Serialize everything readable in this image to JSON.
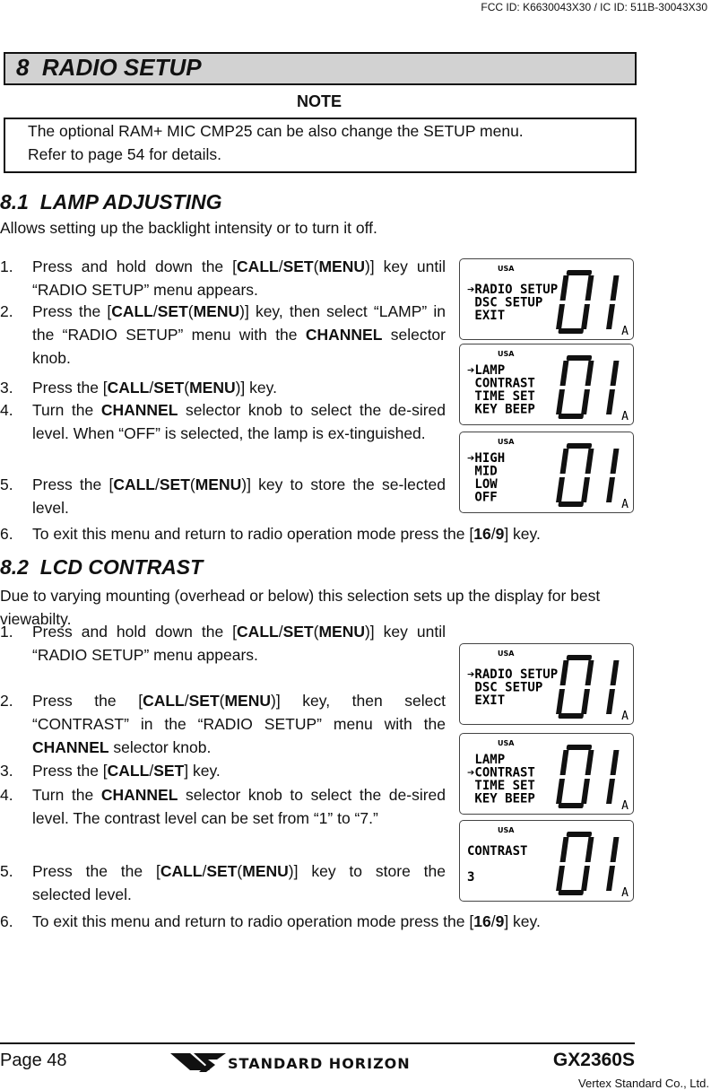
{
  "header": {
    "fcc_id": "FCC ID: K6630043X30 / IC ID: 511B-30043X30",
    "section_title": "8  RADIO SETUP"
  },
  "note": {
    "label": "NOTE",
    "lines": [
      "The optional RAM+ MIC CMP25 can be also change the SETUP menu.",
      "Refer to page 54 for details."
    ]
  },
  "lamp": {
    "heading": "8.1  LAMP ADJUSTING",
    "intro": "Allows setting up the backlight intensity or to turn it off.",
    "steps": [
      {
        "num": "1.",
        "segs": [
          [
            "Press and hold down the ",
            0
          ],
          [
            "[",
            0
          ],
          [
            "CALL",
            1
          ],
          [
            "/",
            0
          ],
          [
            "SET",
            1
          ],
          [
            "(",
            0
          ],
          [
            "MENU",
            1
          ],
          [
            ")] key until “RADIO SETUP” menu appears.",
            0
          ]
        ]
      },
      {
        "num": "2.",
        "segs": [
          [
            "Press the [",
            0
          ],
          [
            "CALL",
            1
          ],
          [
            "/",
            0
          ],
          [
            "SET",
            1
          ],
          [
            "(",
            0
          ],
          [
            "MENU",
            1
          ],
          [
            ")] key, then select “LAMP” in the “RADIO SETUP” menu with the ",
            0
          ],
          [
            "CHANNEL",
            1
          ],
          [
            " selector knob.",
            0
          ]
        ]
      },
      {
        "num": "3.",
        "segs": [
          [
            "Press the [",
            0
          ],
          [
            "CALL",
            1
          ],
          [
            "/",
            0
          ],
          [
            "SET",
            1
          ],
          [
            "(",
            0
          ],
          [
            "MENU",
            1
          ],
          [
            ")] key.",
            0
          ]
        ]
      },
      {
        "num": "4.",
        "segs": [
          [
            "Turn the ",
            0
          ],
          [
            "CHANNEL",
            1
          ],
          [
            " selector knob to select the de-sired level. When “OFF” is selected, the lamp is ex-tinguished.",
            0
          ]
        ]
      },
      {
        "num": "5.",
        "segs": [
          [
            "Press the [",
            0
          ],
          [
            "CALL",
            1
          ],
          [
            "/",
            0
          ],
          [
            "SET",
            1
          ],
          [
            "(",
            0
          ],
          [
            "MENU",
            1
          ],
          [
            ")] key to store the se-lected level.",
            0
          ]
        ]
      },
      {
        "num": "6.",
        "segs": [
          [
            "To exit this menu and return to radio operation mode press the [",
            0
          ],
          [
            "16",
            1
          ],
          [
            "/",
            0
          ],
          [
            "9",
            1
          ],
          [
            "] key.",
            0
          ]
        ]
      }
    ],
    "displays": [
      {
        "region": "USA",
        "lines": [
          "➔RADIO SETUP",
          " DSC SETUP",
          " EXIT"
        ],
        "channel": "01",
        "suffix": "A"
      },
      {
        "region": "USA",
        "lines": [
          "➔LAMP",
          " CONTRAST",
          " TIME SET",
          " KEY BEEP"
        ],
        "channel": "01",
        "suffix": "A"
      },
      {
        "region": "USA",
        "lines": [
          "➔HIGH",
          " MID",
          " LOW",
          " OFF"
        ],
        "channel": "01",
        "suffix": "A"
      }
    ]
  },
  "contrast": {
    "heading": "8.2  LCD CONTRAST",
    "intro": "Due to varying mounting (overhead or below) this selection sets up the display for best viewabilty.",
    "steps": [
      {
        "num": "1.",
        "segs": [
          [
            "Press and hold down the [",
            0
          ],
          [
            "CALL",
            1
          ],
          [
            "/",
            0
          ],
          [
            "SET",
            1
          ],
          [
            "(",
            0
          ],
          [
            "MENU",
            1
          ],
          [
            ")] key until “RADIO SETUP” menu appears.",
            0
          ]
        ]
      },
      {
        "num": "2.",
        "segs": [
          [
            "Press the [",
            0
          ],
          [
            "CALL",
            1
          ],
          [
            "/",
            0
          ],
          [
            "SET",
            1
          ],
          [
            "(",
            0
          ],
          [
            "MENU",
            1
          ],
          [
            ")] key, then select “CONTRAST” in the “RADIO SETUP” menu with the ",
            0
          ],
          [
            "CHANNEL",
            1
          ],
          [
            " selector knob.",
            0
          ]
        ]
      },
      {
        "num": "3.",
        "segs": [
          [
            "Press the [",
            0
          ],
          [
            "CALL",
            1
          ],
          [
            "/",
            0
          ],
          [
            "SET",
            1
          ],
          [
            "] key.",
            0
          ]
        ]
      },
      {
        "num": "4.",
        "segs": [
          [
            "Turn the ",
            0
          ],
          [
            "CHANNEL",
            1
          ],
          [
            " selector knob to select the de-sired level. The contrast level can be set from “1” to “7.”",
            0
          ]
        ]
      },
      {
        "num": "5.",
        "segs": [
          [
            "Press the the [",
            0
          ],
          [
            "CALL",
            1
          ],
          [
            "/",
            0
          ],
          [
            "SET",
            1
          ],
          [
            "(",
            0
          ],
          [
            "MENU",
            1
          ],
          [
            ")] key to store the selected level.",
            0
          ]
        ]
      },
      {
        "num": "6.",
        "segs": [
          [
            "To exit this menu and return to radio operation mode press the [",
            0
          ],
          [
            "16",
            1
          ],
          [
            "/",
            0
          ],
          [
            "9",
            1
          ],
          [
            "] key.",
            0
          ]
        ]
      }
    ],
    "displays": [
      {
        "region": "USA",
        "lines": [
          "➔RADIO SETUP",
          " DSC SETUP",
          " EXIT"
        ],
        "channel": "01",
        "suffix": "A"
      },
      {
        "region": "USA",
        "lines": [
          " LAMP",
          "➔CONTRAST",
          " TIME SET",
          " KEY BEEP"
        ],
        "channel": "01",
        "suffix": "A"
      },
      {
        "region": "USA",
        "lines": [
          "CONTRAST",
          "",
          "3"
        ],
        "channel": "01",
        "suffix": "A"
      }
    ]
  },
  "footer": {
    "page": "Page 48",
    "brand": "STANDARD HORIZON",
    "model": "GX2360S",
    "company": "Vertex Standard Co., Ltd."
  }
}
